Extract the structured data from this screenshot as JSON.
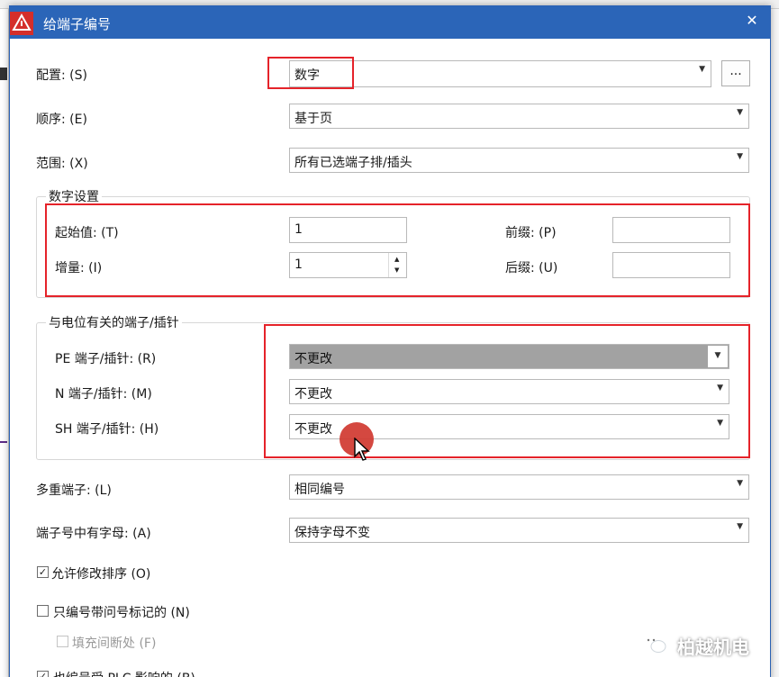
{
  "window": {
    "title": "给端子编号",
    "close_glyph": "✕"
  },
  "config": {
    "label": "配置: (S)",
    "value": "数字",
    "more_label": "..."
  },
  "order": {
    "label": "顺序: (E)",
    "value": "基于页"
  },
  "scope": {
    "label": "范围: (X)",
    "value": "所有已选端子排/插头"
  },
  "number_settings": {
    "title": "数字设置",
    "start_label": "起始值: (T)",
    "start_value": "1",
    "increment_label": "增量: (I)",
    "increment_value": "1",
    "prefix_label": "前缀: (P)",
    "prefix_value": "",
    "suffix_label": "后缀: (U)",
    "suffix_value": ""
  },
  "potential_terminals": {
    "title": "与电位有关的端子/插针",
    "pe_label": "PE 端子/插针: (R)",
    "pe_value": "不更改",
    "n_label": "N 端子/插针: (M)",
    "n_value": "不更改",
    "sh_label": "SH 端子/插针: (H)",
    "sh_value": "不更改"
  },
  "multi_terminal": {
    "label": "多重端子: (L)",
    "value": "相同编号"
  },
  "letters": {
    "label": "端子号中有字母: (A)",
    "value": "保持字母不变"
  },
  "options": {
    "allow_reorder": {
      "label": "允许修改排序 (O)",
      "checked": true
    },
    "only_question": {
      "label": "只编号带问号标记的 (N)",
      "checked": false
    },
    "fill_gaps": {
      "label": "填充间断处 (F)",
      "checked": false
    },
    "plc_partial": {
      "label": "也编号受 PLC 影响的 (B)",
      "checked": true
    }
  },
  "watermark": {
    "text": "柏越机电"
  },
  "colors": {
    "titlebar": "#2b65b8",
    "annotation_red": "#e5232a",
    "highlight": "#a2a2a2"
  }
}
